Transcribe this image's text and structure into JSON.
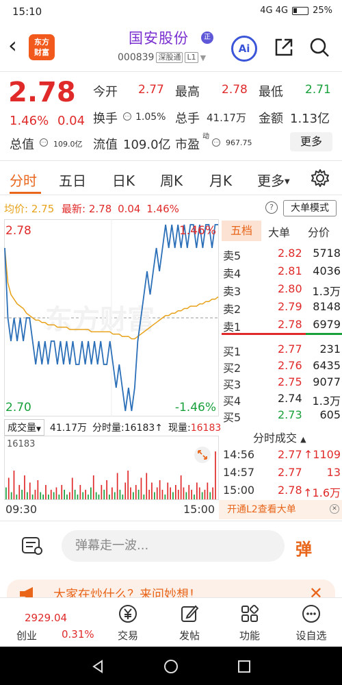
{
  "status": {
    "time": "15:10",
    "signal": "4G 4G",
    "battery": "25%"
  },
  "header": {
    "logo_line1": "东方",
    "logo_line2": "财富",
    "stock_name": "国安股份",
    "stock_badge": "正",
    "code": "000839",
    "connect": "深股通",
    "level": "L1",
    "ai_label": "Ai"
  },
  "quote": {
    "price": "2.78",
    "change_pct": "1.46%",
    "change_abs": "0.04",
    "open_label": "今开",
    "open": "2.77",
    "high_label": "最高",
    "high": "2.78",
    "low_label": "最低",
    "low": "2.71",
    "turnover_label": "换手",
    "turnover": "1.05%",
    "volume_label": "总手",
    "volume": "41.17万",
    "amount_label": "金额",
    "amount": "1.13亿",
    "mktcap_label": "总值",
    "mktcap": "109.0亿",
    "float_label": "流值",
    "float": "109.0亿",
    "pe_label": "市盈",
    "pe_sup": "动",
    "pe": "967.75",
    "more_label": "更多"
  },
  "tabs": [
    "分时",
    "五日",
    "日K",
    "周K",
    "月K",
    "更多"
  ],
  "price_line": {
    "avg_label": "均价:",
    "avg": "2.75",
    "latest_label": "最新:",
    "latest": "2.78",
    "chg": "0.04",
    "pct": "1.46%",
    "mode_label": "大单模式"
  },
  "chart_data": {
    "type": "line",
    "y_max_label": "2.78",
    "y_min_label": "2.70",
    "pct_max_label": "1.46%",
    "pct_min_label": "-1.46%",
    "ylim": [
      2.7,
      2.78
    ],
    "prev_close": 2.74,
    "series": [
      {
        "values": [
          2.77,
          2.74,
          2.73,
          2.74,
          2.73,
          2.74,
          2.73,
          2.74,
          2.74,
          2.73,
          2.72,
          2.73,
          2.72,
          2.73,
          2.72,
          2.73,
          2.73,
          2.72,
          2.73,
          2.72,
          2.73,
          2.72,
          2.73,
          2.72,
          2.72,
          2.73,
          2.72,
          2.73,
          2.72,
          2.73,
          2.72,
          2.73,
          2.72,
          2.72,
          2.73,
          2.72,
          2.71,
          2.72,
          2.71,
          2.7,
          2.71,
          2.7,
          2.71,
          2.73,
          2.74,
          2.75,
          2.76,
          2.75,
          2.76,
          2.77,
          2.76,
          2.77,
          2.78,
          2.77,
          2.78,
          2.77,
          2.78,
          2.77,
          2.78,
          2.77,
          2.78,
          2.78,
          2.77,
          2.78,
          2.77,
          2.78,
          2.78,
          2.77,
          2.78,
          2.78
        ]
      },
      {
        "values": [
          2.77,
          2.755,
          2.75,
          2.748,
          2.746,
          2.745,
          2.744,
          2.742,
          2.741,
          2.74,
          2.739,
          2.739,
          2.738,
          2.738,
          2.737,
          2.737,
          2.737,
          2.736,
          2.736,
          2.736,
          2.736,
          2.735,
          2.735,
          2.735,
          2.735,
          2.735,
          2.735,
          2.735,
          2.734,
          2.734,
          2.734,
          2.734,
          2.734,
          2.734,
          2.734,
          2.733,
          2.733,
          2.733,
          2.732,
          2.732,
          2.732,
          2.731,
          2.731,
          2.732,
          2.733,
          2.734,
          2.735,
          2.736,
          2.737,
          2.738,
          2.739,
          2.74,
          2.741,
          2.741,
          2.742,
          2.742,
          2.743,
          2.743,
          2.744,
          2.744,
          2.745,
          2.745,
          2.745,
          2.746,
          2.746,
          2.747,
          2.747,
          2.748,
          2.748,
          2.749
        ]
      }
    ],
    "watermark": "东方财富"
  },
  "orderbook": {
    "tabs": [
      "五档",
      "大单",
      "分价"
    ],
    "asks": [
      {
        "label": "卖5",
        "price": "2.82",
        "vol": "5718"
      },
      {
        "label": "卖4",
        "price": "2.81",
        "vol": "4036"
      },
      {
        "label": "卖3",
        "price": "2.80",
        "vol": "1.3万"
      },
      {
        "label": "卖2",
        "price": "2.79",
        "vol": "8148"
      },
      {
        "label": "卖1",
        "price": "2.78",
        "vol": "6979"
      }
    ],
    "bids": [
      {
        "label": "买1",
        "price": "2.77",
        "vol": "231"
      },
      {
        "label": "买2",
        "price": "2.76",
        "vol": "6435"
      },
      {
        "label": "买3",
        "price": "2.75",
        "vol": "9077"
      },
      {
        "label": "买4",
        "price": "2.74",
        "vol": "1.3万"
      },
      {
        "label": "买5",
        "price": "2.73",
        "vol": "605"
      }
    ]
  },
  "volume": {
    "select_label": "成交量",
    "total": "41.17万",
    "period_label": "分时量:16183↑",
    "now_label": "现量:",
    "now": "16183",
    "max_label": "16183",
    "bars": [
      0.25,
      0.45,
      0.15,
      0.6,
      0.1,
      0.3,
      0.2,
      0.5,
      0.15,
      0.35,
      0.1,
      0.2,
      0.4,
      0.15,
      0.1,
      0.3,
      0.1,
      0.2,
      0.15,
      0.25,
      0.1,
      0.3,
      0.2,
      0.1,
      0.15,
      0.45,
      0.2,
      0.1,
      0.3,
      0.15,
      0.2,
      0.1,
      0.25,
      0.5,
      0.15,
      0.1,
      0.3,
      0.2,
      0.4,
      0.1,
      0.25,
      0.15,
      0.55,
      0.2,
      0.1,
      0.35,
      0.6,
      0.25,
      0.15,
      0.3,
      0.2,
      0.45,
      0.1,
      0.55,
      0.2,
      0.35,
      0.15,
      0.25,
      0.4,
      0.2,
      0.1,
      0.35,
      0.25,
      0.15,
      0.3,
      0.2,
      0.5,
      0.25,
      0.15,
      0.3,
      0.2,
      0.1,
      0.35,
      0.25,
      0.15,
      0.2,
      0.35,
      0.15,
      0.25,
      1.0
    ],
    "bar_colors": [
      "g",
      "r",
      "g",
      "r",
      "g",
      "r",
      "g",
      "r",
      "g",
      "r",
      "g",
      "r",
      "r",
      "g",
      "g",
      "r",
      "g",
      "r",
      "g",
      "r",
      "g",
      "r",
      "g",
      "g",
      "r",
      "r",
      "g",
      "g",
      "r",
      "g",
      "r",
      "g",
      "g",
      "r",
      "g",
      "g",
      "r",
      "g",
      "r",
      "g",
      "r",
      "g",
      "r",
      "g",
      "g",
      "r",
      "r",
      "r",
      "g",
      "r",
      "g",
      "r",
      "g",
      "r",
      "r",
      "r",
      "g",
      "r",
      "r",
      "r",
      "g",
      "r",
      "r",
      "g",
      "r",
      "r",
      "r",
      "r",
      "g",
      "r",
      "r",
      "g",
      "r",
      "r",
      "g",
      "r",
      "r",
      "g",
      "r",
      "r"
    ],
    "time_start": "09:30",
    "time_end": "15:00"
  },
  "trades": {
    "title": "分时成交",
    "rows": [
      {
        "time": "14:56",
        "price": "2.77",
        "arrow": "↑",
        "vol": "1109"
      },
      {
        "time": "14:57",
        "price": "2.77",
        "arrow": "",
        "vol": "13"
      },
      {
        "time": "15:00",
        "price": "2.78",
        "arrow": "↑",
        "vol": "1.6万"
      }
    ],
    "l2_banner": "开通L2查看大单"
  },
  "danmaku": {
    "placeholder": "弹幕走一波...",
    "send_label": "弹"
  },
  "ai_banner": {
    "text": "大家在炒什么？来问妙想！"
  },
  "bottom_nav": {
    "index_value": "2929.04",
    "index_name": "创业",
    "index_pct": "0.31%",
    "items": [
      "交易",
      "发帖",
      "功能",
      "设自选"
    ]
  },
  "colors": {
    "red": "#e02a2a",
    "green": "#17a03a",
    "orange": "#e8651a",
    "price_line": "#2a6fb8",
    "avg_line": "#e8a21a"
  }
}
